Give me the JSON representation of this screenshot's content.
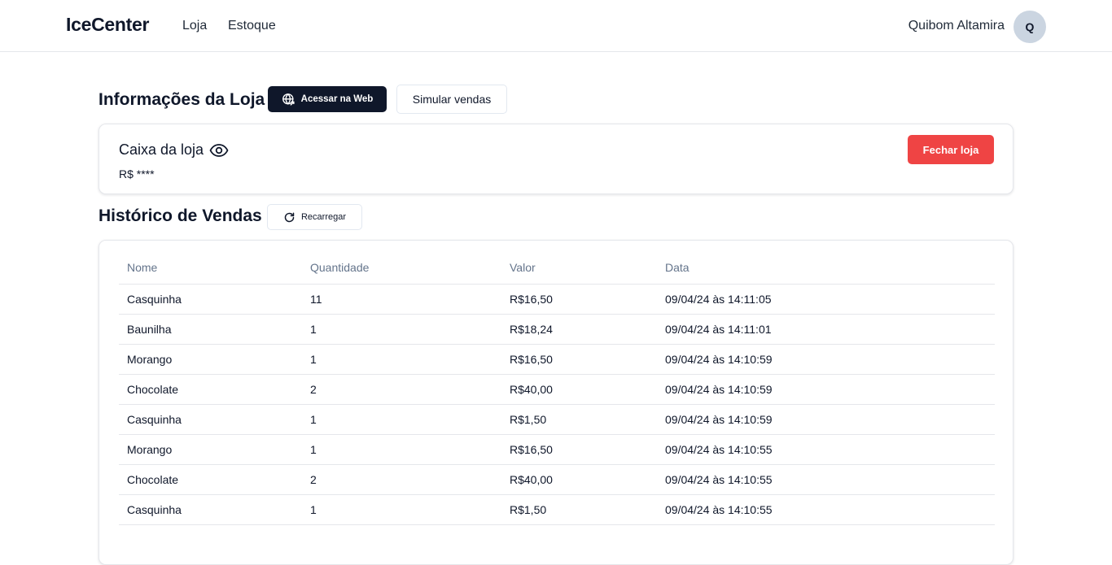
{
  "header": {
    "brand": "IceCenter",
    "nav": [
      {
        "label": "Loja"
      },
      {
        "label": "Estoque"
      }
    ],
    "user": {
      "name": "Quibom Altamira",
      "initial": "Q"
    }
  },
  "store_info": {
    "title": "Informações da Loja",
    "web_button": "Acessar na Web",
    "simulate_button": "Simular vendas",
    "cash": {
      "title": "Caixa da loja",
      "value": "R$ ****",
      "close_button": "Fechar loja"
    }
  },
  "history": {
    "title": "Histórico de Vendas",
    "reload_button": "Recarregar",
    "columns": [
      "Nome",
      "Quantidade",
      "Valor",
      "Data"
    ],
    "rows": [
      [
        "Casquinha",
        "11",
        "R$16,50",
        "09/04/24 às 14:11:05"
      ],
      [
        "Baunilha",
        "1",
        "R$18,24",
        "09/04/24 às 14:11:01"
      ],
      [
        "Morango",
        "1",
        "R$16,50",
        "09/04/24 às 14:10:59"
      ],
      [
        "Chocolate",
        "2",
        "R$40,00",
        "09/04/24 às 14:10:59"
      ],
      [
        "Casquinha",
        "1",
        "R$1,50",
        "09/04/24 às 14:10:59"
      ],
      [
        "Morango",
        "1",
        "R$16,50",
        "09/04/24 às 14:10:55"
      ],
      [
        "Chocolate",
        "2",
        "R$40,00",
        "09/04/24 às 14:10:55"
      ],
      [
        "Casquinha",
        "1",
        "R$1,50",
        "09/04/24 às 14:10:55"
      ]
    ]
  },
  "colors": {
    "primary_dark": "#0f172a",
    "danger": "#ef4444",
    "avatar_bg": "#cbd5e1"
  },
  "icons": {
    "web": "globe-icon",
    "visibility": "eye-icon",
    "reload": "refresh-icon"
  }
}
